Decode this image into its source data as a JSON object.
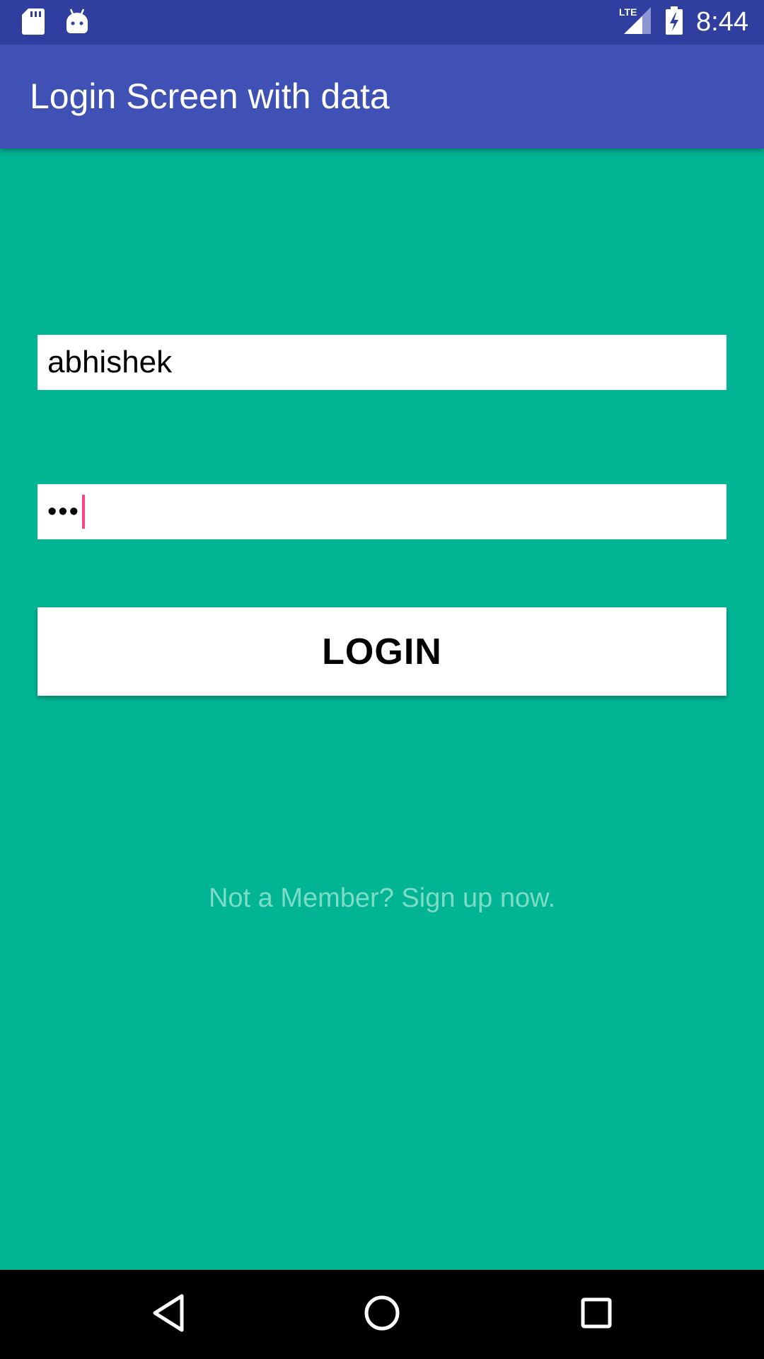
{
  "status_bar": {
    "time": "8:44",
    "network": "LTE",
    "icons": [
      "sd-card-icon",
      "android-icon",
      "signal-icon",
      "battery-charging-icon"
    ]
  },
  "app_bar": {
    "title": "Login Screen with data"
  },
  "form": {
    "username_value": "abhishek",
    "password_value": "•••",
    "login_label": "LOGIN",
    "signup_text": "Not a Member? Sign up now."
  },
  "colors": {
    "status_bar": "#303f9f",
    "app_bar": "#3f51b5",
    "background": "#00b494",
    "accent": "#ff4081",
    "signup_text": "#7ddcc6"
  },
  "nav_bar": {
    "icons": [
      "back-icon",
      "home-icon",
      "recents-icon"
    ]
  }
}
